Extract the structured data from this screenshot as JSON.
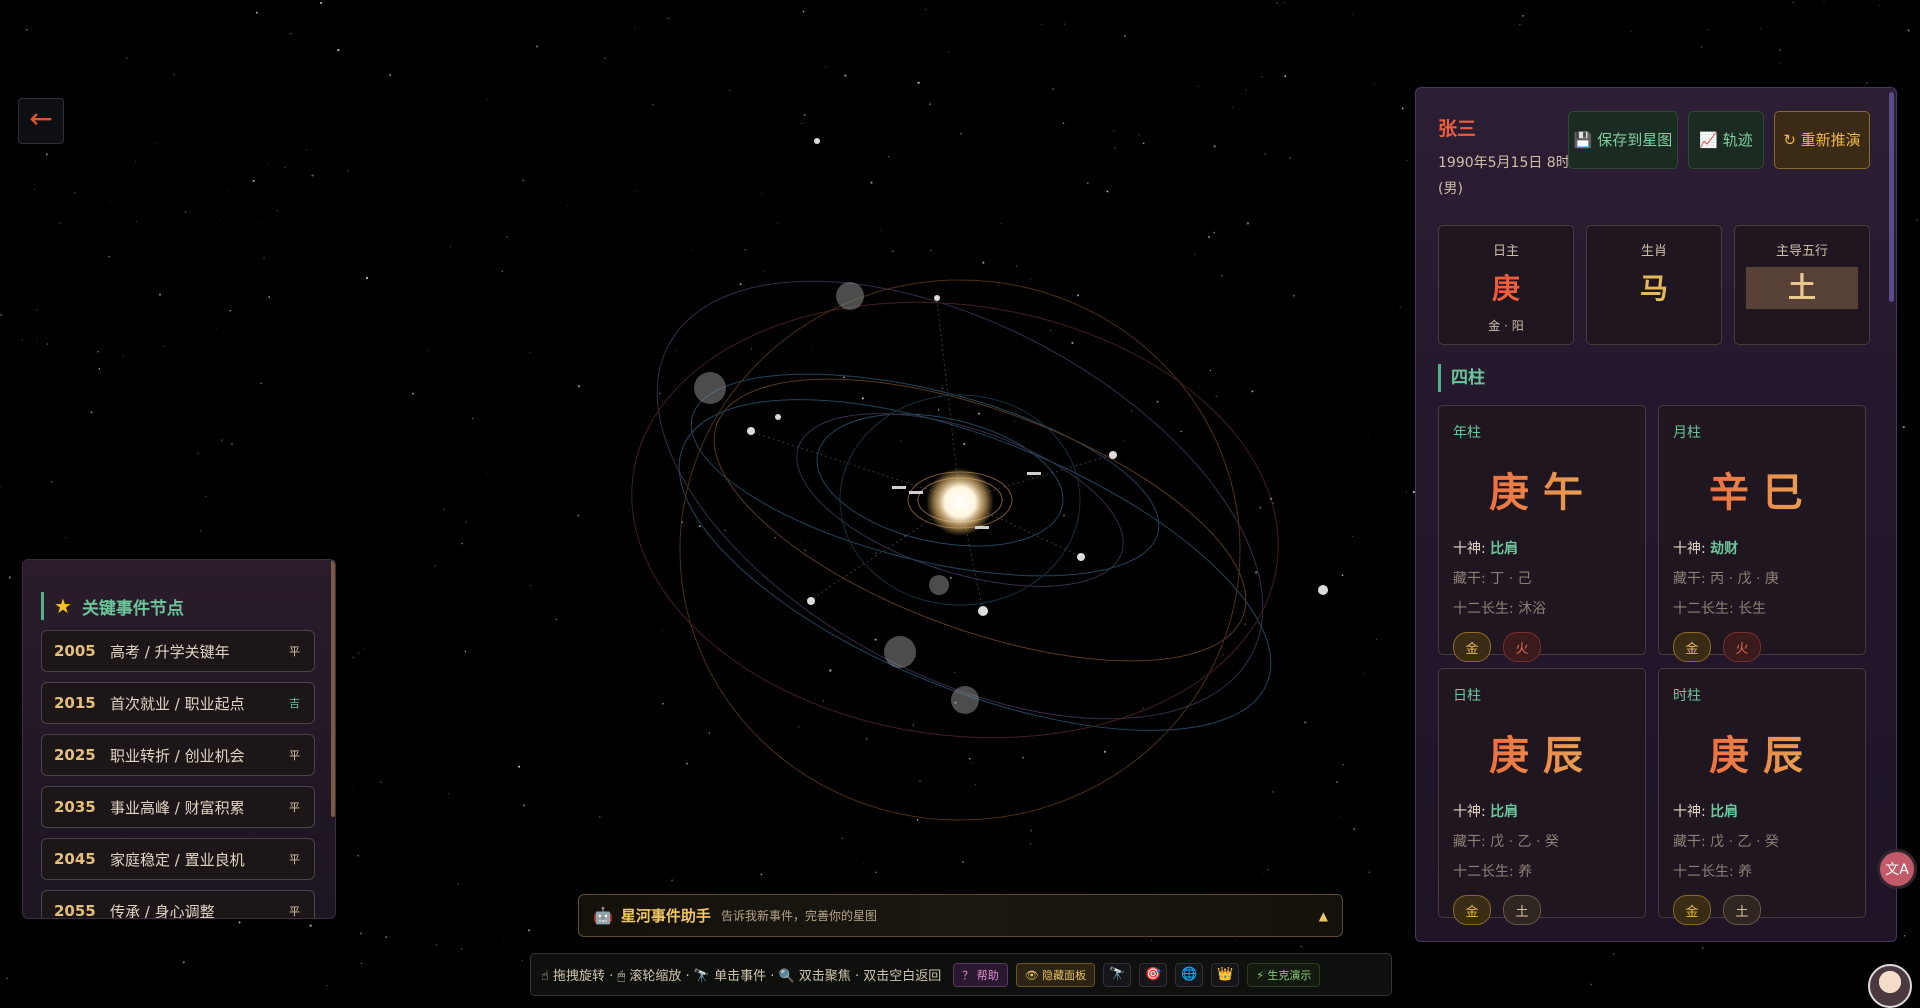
{
  "nav": {
    "back_icon": "←"
  },
  "events": {
    "title": "关键事件节点",
    "items": [
      {
        "year": "2005",
        "text": "高考 / 升学关键年",
        "tag": "平"
      },
      {
        "year": "2015",
        "text": "首次就业 / 职业起点",
        "tag": "吉"
      },
      {
        "year": "2025",
        "text": "职业转折 / 创业机会",
        "tag": "平"
      },
      {
        "year": "2035",
        "text": "事业高峰 / 财富积累",
        "tag": "平"
      },
      {
        "year": "2045",
        "text": "家庭稳定 / 置业良机",
        "tag": "平"
      },
      {
        "year": "2055",
        "text": "传承 / 身心调整",
        "tag": "平"
      }
    ]
  },
  "helper": {
    "icon": "🤖",
    "title": "星河事件助手",
    "subtitle": "告诉我新事件，完善你的星图",
    "toggle": "▲"
  },
  "toolbar": {
    "hint": "☝ 拖拽旋转 · 🖱 滚轮缩放 · 🔭 单击事件 · 🔍 双击聚焦 · 双击空白返回",
    "help": "？ 帮助",
    "hide": "👁 隐藏面板",
    "icons": [
      "🔭",
      "🎯",
      "🌐",
      "👑"
    ],
    "demo": "⚡ 生克演示"
  },
  "profile": {
    "name": "张三",
    "info": "1990年5月15日 8时 (男)",
    "save_btn": "💾 保存到星图",
    "track_btn": "📈 轨迹",
    "rerun_btn": "↻ 重新推演",
    "cards": {
      "day_master": {
        "label": "日主",
        "value": "庚",
        "sub": "金 · 阳"
      },
      "zodiac": {
        "label": "生肖",
        "value": "马"
      },
      "element": {
        "label": "主导五行",
        "value": "土"
      }
    },
    "pillars_title": "四柱",
    "pillars": [
      {
        "label": "年柱",
        "chars": "庚午",
        "god_label": "十神: ",
        "god": "比肩",
        "hidden": "藏干: 丁 · 己",
        "stage": "十二长生: 沐浴",
        "tags": [
          "金",
          "火"
        ]
      },
      {
        "label": "月柱",
        "chars": "辛巳",
        "god_label": "十神: ",
        "god": "劫财",
        "hidden": "藏干: 丙 · 戊 · 庚",
        "stage": "十二长生: 长生",
        "tags": [
          "金",
          "火"
        ]
      },
      {
        "label": "日柱",
        "chars": "庚辰",
        "god_label": "十神: ",
        "god": "比肩",
        "hidden": "藏干: 戊 · 乙 · 癸",
        "stage": "十二长生: 养",
        "tags": [
          "金",
          "土"
        ]
      },
      {
        "label": "时柱",
        "chars": "庚辰",
        "god_label": "十神: ",
        "god": "比肩",
        "hidden": "藏干: 戊 · 乙 · 癸",
        "stage": "十二长生: 养",
        "tags": [
          "金",
          "土"
        ]
      }
    ]
  },
  "fab": {
    "translate": "文A"
  }
}
